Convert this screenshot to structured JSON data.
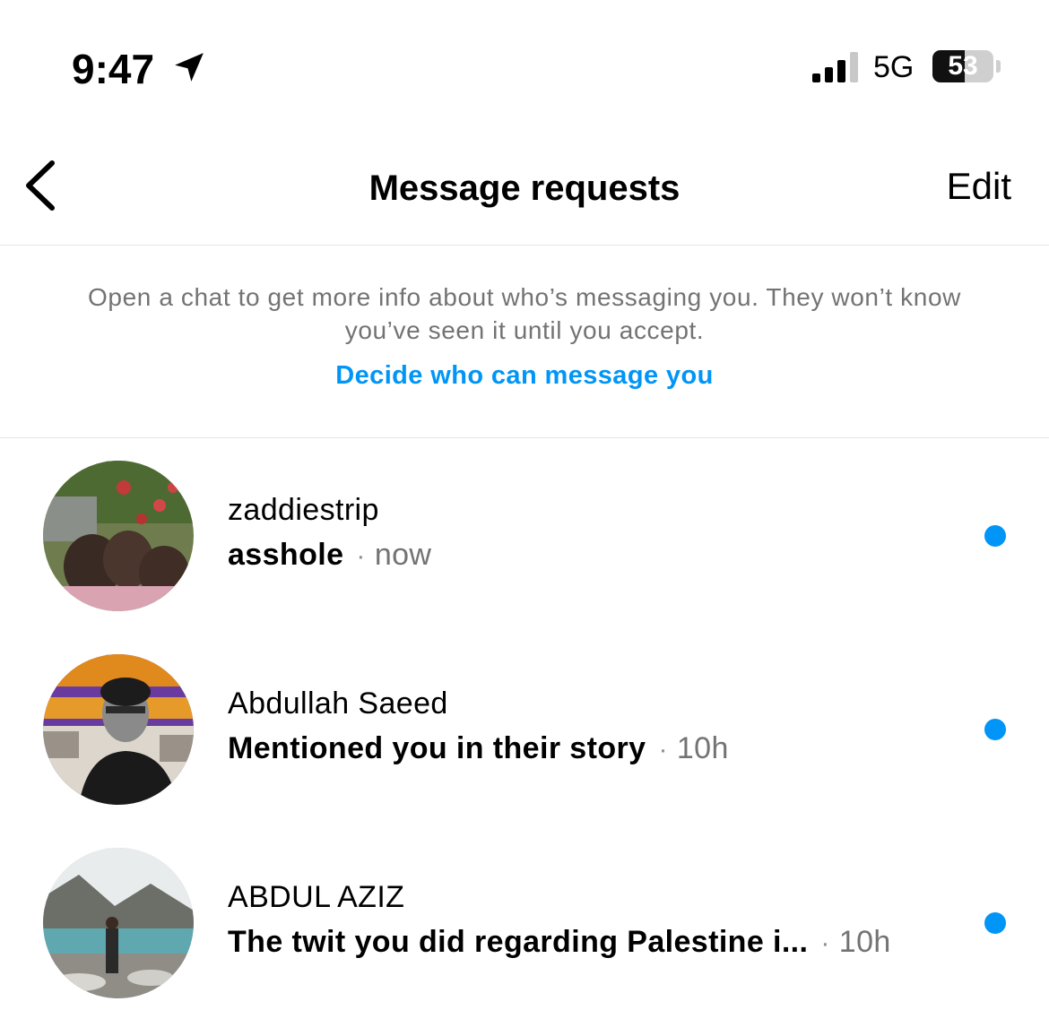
{
  "status_bar": {
    "time": "9:47",
    "network": "5G",
    "battery_level": "53",
    "battery_fraction": 0.53
  },
  "header": {
    "title": "Message requests",
    "edit_label": "Edit"
  },
  "info": {
    "text": "Open a chat to get more info about who’s messaging you. They won’t know you’ve seen it until you accept.",
    "link": "Decide who can message you"
  },
  "requests": [
    {
      "name": "zaddiestrip",
      "message": "asshole",
      "separator": "·",
      "time": "now",
      "unread": true
    },
    {
      "name": "Abdullah Saeed",
      "message": "Mentioned you in their story",
      "separator": "·",
      "time": "10h",
      "unread": true
    },
    {
      "name": "ABDUL AZIZ",
      "message": "The twit you did regarding Palestine i...",
      "separator": "·",
      "time": "10h",
      "unread": true
    }
  ],
  "colors": {
    "accent": "#0095f6",
    "secondary_text": "#737373",
    "divider": "#e6e6e6"
  },
  "icons": {
    "back": "chevron-left-icon",
    "location": "location-arrow-icon",
    "signal": "cellular-signal-icon",
    "unread": "unread-dot"
  }
}
